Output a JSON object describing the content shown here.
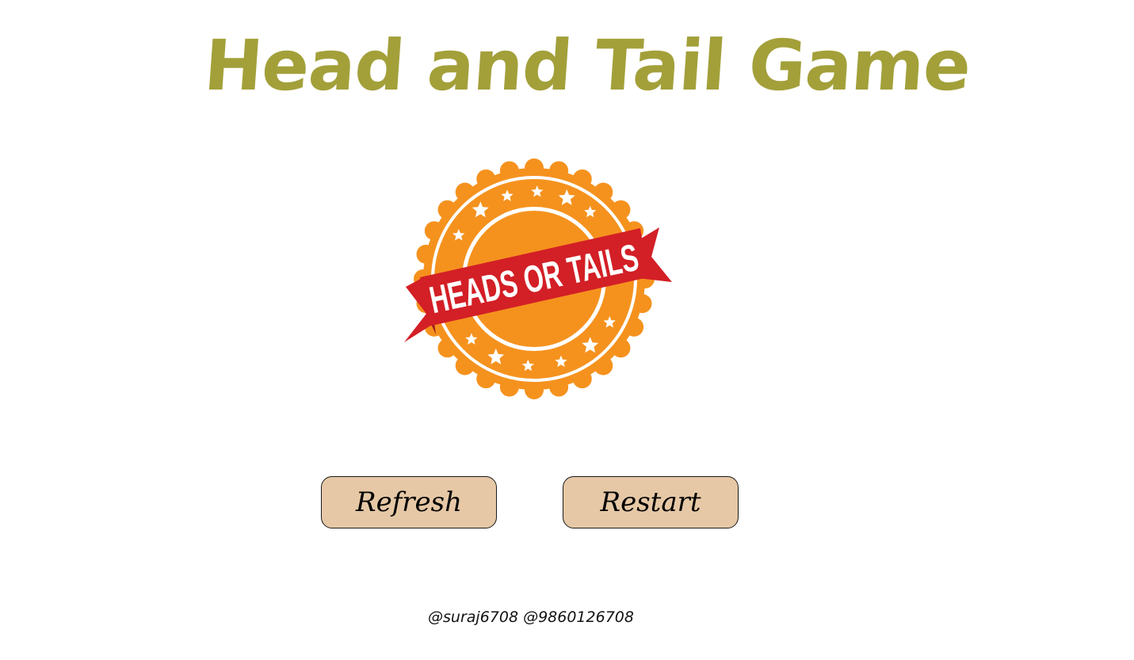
{
  "app": {
    "title": "Head and Tail Game"
  },
  "badge": {
    "image_text": "HEADS OR TAILS",
    "icon": "heads-or-tails-badge-icon"
  },
  "controls": {
    "refresh_label": "Refresh",
    "restart_label": "Restart"
  },
  "footer": {
    "credit": "@suraj6708 @9860126708"
  },
  "colors": {
    "title": "#a3a03a",
    "button_bg": "#e6c8a6",
    "badge_orange": "#f5921e",
    "ribbon_red": "#d31f26",
    "ribbon_dark_red": "#9e1a1f"
  }
}
